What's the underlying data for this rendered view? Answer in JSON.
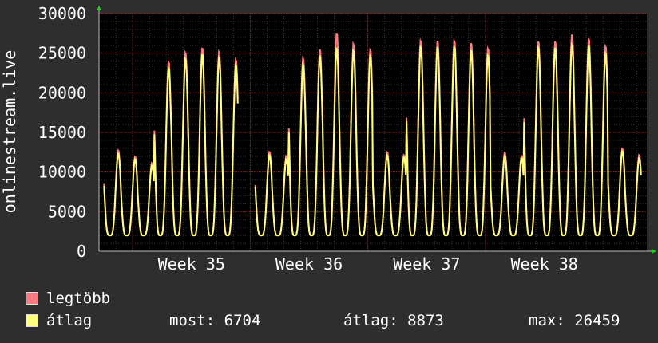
{
  "chart_data": {
    "type": "line",
    "ylabel": "onlinestream.live",
    "ylim": [
      0,
      30000
    ],
    "yticks": [
      0,
      5000,
      10000,
      15000,
      20000,
      25000,
      30000
    ],
    "xticks": [
      "Week 35",
      "Week 36",
      "Week 37",
      "Week 38"
    ],
    "grid": true,
    "colors": {
      "legtobb": "#ff7a80",
      "atlag": "#ffff80",
      "background": "#000000",
      "grid_minor": "#3a3a3a",
      "grid_major": "#7a2a2a"
    },
    "day_peaks_atlag": [
      12400,
      11700,
      10900,
      23200,
      24400,
      25000,
      24500,
      23600,
      12200,
      12200,
      11700,
      23700,
      24800,
      25700,
      25400,
      24700,
      12200,
      11900,
      25900,
      25900,
      25900,
      25500,
      24800,
      12100,
      11800,
      25800,
      25800,
      26200,
      26100,
      25100,
      12700,
      11800
    ],
    "day_peaks_legtobb": [
      12800,
      12000,
      11200,
      24000,
      25200,
      25800,
      25300,
      24300,
      12500,
      12600,
      12100,
      24500,
      25600,
      27700,
      26300,
      25500,
      12600,
      12200,
      26700,
      26700,
      26700,
      26400,
      25700,
      12500,
      12100,
      26600,
      26600,
      27500,
      27000,
      26000,
      13000,
      12200
    ],
    "trough": 2000,
    "gap_days": [
      8
    ],
    "series": [
      {
        "name": "legtöbb",
        "color": "#ff7a80"
      },
      {
        "name": "átlag",
        "color": "#ffff80"
      }
    ]
  },
  "legend": {
    "max_label": "legtöbb",
    "avg_label": "átlag"
  },
  "stats": {
    "now": "most: 6704",
    "avg": "átlag: 8873",
    "max": "max: 26459"
  }
}
